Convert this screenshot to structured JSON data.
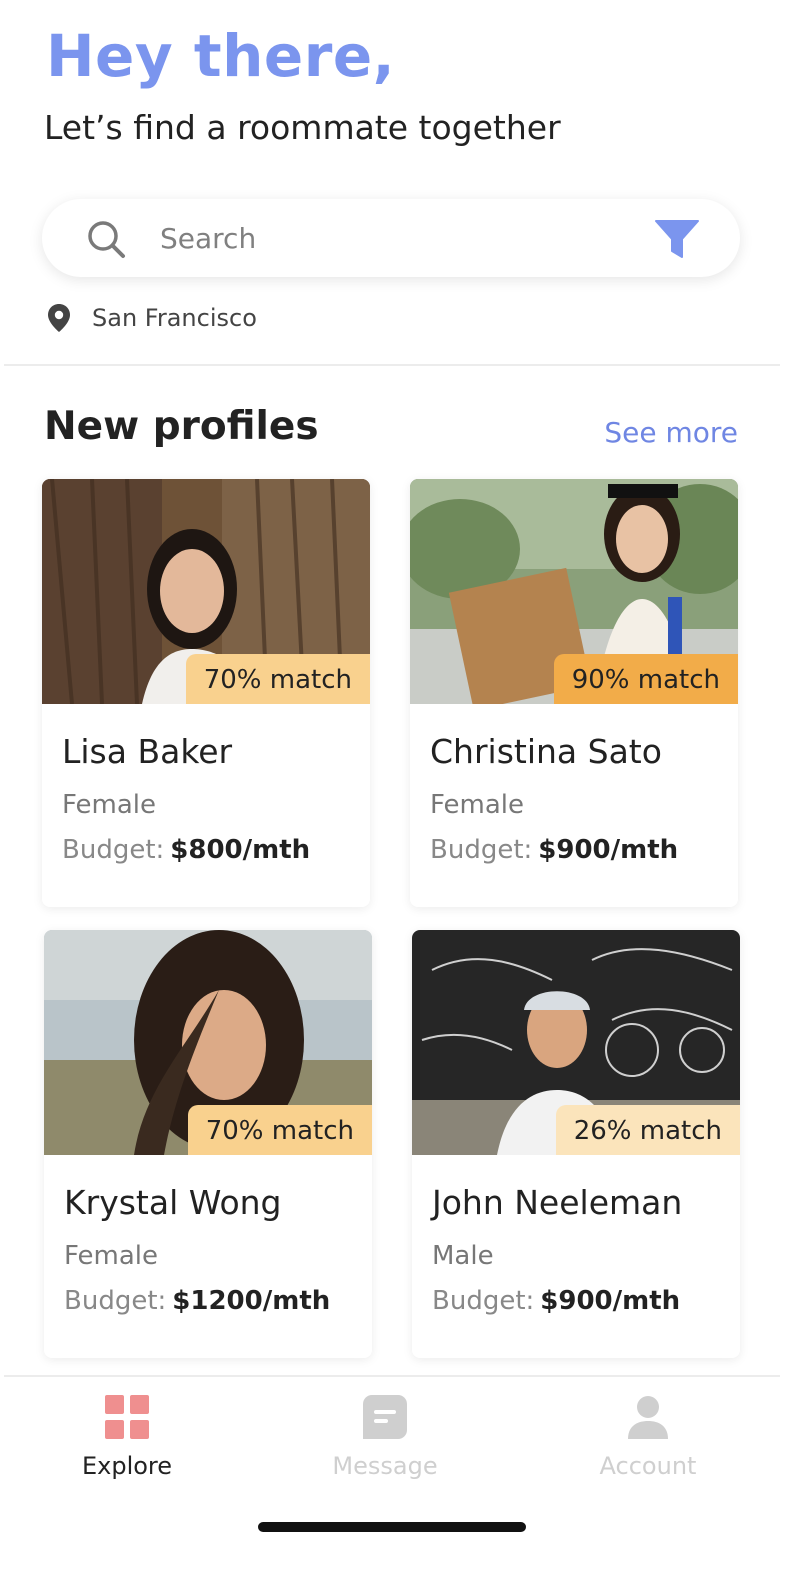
{
  "header": {
    "greeting": "Hey there,",
    "subtitle": "Let’s find a roommate together"
  },
  "search": {
    "placeholder": "Search",
    "value": ""
  },
  "location": {
    "label": "San Francisco"
  },
  "section": {
    "title": "New profiles",
    "see_more": "See more"
  },
  "profiles": [
    {
      "name": "Lisa Baker",
      "gender": "Female",
      "budget_label": "Budget:",
      "budget": "$800/mth",
      "match": "70% match",
      "match_color": "#f9d18e"
    },
    {
      "name": "Christina Sato",
      "gender": "Female",
      "budget_label": "Budget:",
      "budget": "$900/mth",
      "match": "90% match",
      "match_color": "#f2ac49"
    },
    {
      "name": "Krystal Wong",
      "gender": "Female",
      "budget_label": "Budget:",
      "budget": "$1200/mth",
      "match": "70% match",
      "match_color": "#f9d18e"
    },
    {
      "name": "John Neeleman",
      "gender": "Male",
      "budget_label": "Budget:",
      "budget": "$900/mth",
      "match": "26% match",
      "match_color": "#fbe4bb"
    }
  ],
  "tabs": [
    {
      "label": "Explore",
      "icon": "grid-icon",
      "active": true
    },
    {
      "label": "Message",
      "icon": "chat-icon",
      "active": false
    },
    {
      "label": "Account",
      "icon": "user-icon",
      "active": false
    }
  ],
  "colors": {
    "accent": "#7b95ee",
    "link": "#6f86e3",
    "tab_active_icon": "#ef8f8f",
    "tab_inactive": "#cfcfcf"
  }
}
